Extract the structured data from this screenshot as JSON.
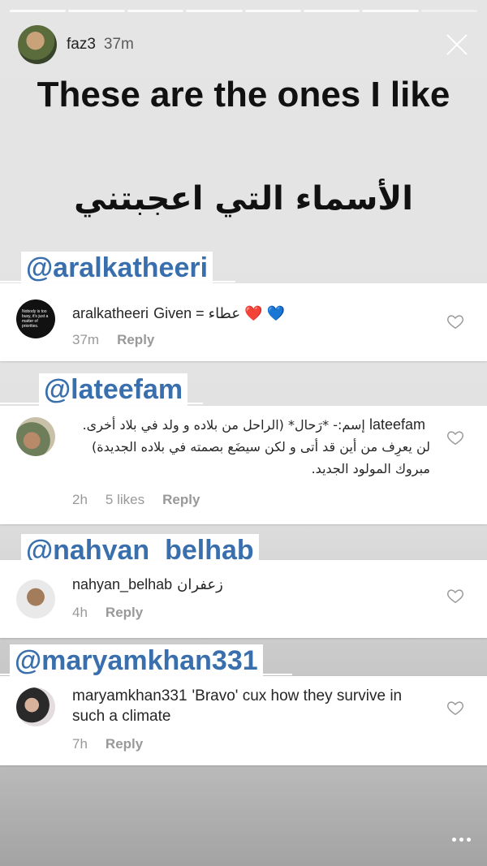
{
  "story": {
    "username": "faz3",
    "time": "37m",
    "title": "These are the ones I like",
    "arabic_title": "الأسماء التي اعجبتني",
    "segments": 8
  },
  "tags": [
    "@aralkatheeri",
    "@lateefam",
    "@nahyan_belhab",
    "@maryamkhan331"
  ],
  "comments": [
    {
      "username": "aralkatheeri",
      "text": "Given = عطاء ❤️ 💙",
      "time": "37m",
      "likes": "",
      "reply": "Reply",
      "avatar_text": "Nobody is too busy, it's just a matter of priorities."
    },
    {
      "username": "lateefam",
      "text": "إسم:- *رَحال* (الراحل من بلاده و ولد في بلاد أخرى. لن يعرِف من أين قد أتى و لكن سيضَع بصمته في بلاده الجديدة) مبروك المولود الجديد.",
      "time": "2h",
      "likes": "5 likes",
      "reply": "Reply"
    },
    {
      "username": "nahyan_belhab",
      "text": "زعفران",
      "time": "4h",
      "likes": "",
      "reply": "Reply"
    },
    {
      "username": "maryamkhan331",
      "text": "'Bravo' cux how they survive in such a climate",
      "time": "7h",
      "likes": "",
      "reply": "Reply"
    }
  ],
  "colors": {
    "tag": "#3a6fae",
    "meta": "#999999",
    "heart_red": "#e0245e",
    "heart_blue": "#3897f0"
  }
}
